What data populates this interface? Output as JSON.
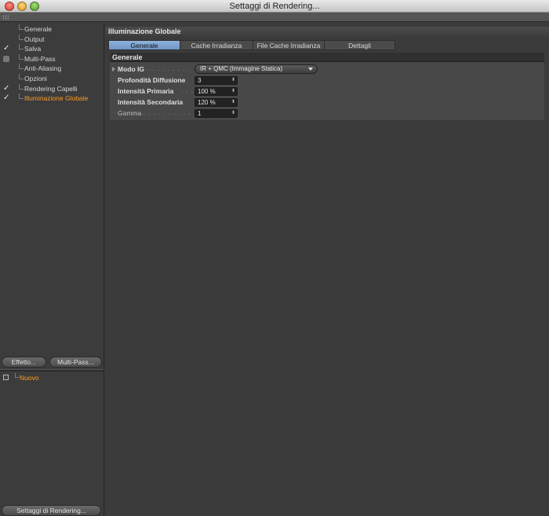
{
  "window": {
    "title": "Settaggi di Rendering..."
  },
  "sidebar": {
    "items": [
      {
        "label": "Generale",
        "state": "none",
        "active": false
      },
      {
        "label": "Output",
        "state": "none",
        "active": false
      },
      {
        "label": "Salva",
        "state": "check",
        "active": false
      },
      {
        "label": "Multi-Pass",
        "state": "box",
        "active": false
      },
      {
        "label": "Anti-Aliasing",
        "state": "none",
        "active": false
      },
      {
        "label": "Opzioni",
        "state": "none",
        "active": false
      },
      {
        "label": "Rendering Capelli",
        "state": "check",
        "active": false
      },
      {
        "label": "Illuminazione Globale",
        "state": "check",
        "active": true
      }
    ],
    "effetto_label": "Effetto...",
    "multipass_label": "Multi-Pass...",
    "preset_label": "Nuovo",
    "settings_button_label": "Settaggi di Rendering..."
  },
  "main": {
    "section_title": "Illuminazione Globale",
    "tabs": [
      {
        "label": "Generale",
        "active": true
      },
      {
        "label": "Cache Irradianza",
        "active": false
      },
      {
        "label": "File Cache Irradianza",
        "active": false
      },
      {
        "label": "Dettagli",
        "active": false
      }
    ],
    "group_title": "Generale",
    "fields": {
      "modo_ig": {
        "label": "Modo IG",
        "value": "IR + QMC (Immagine Statica)"
      },
      "profondita": {
        "label": "Profondità Diffusione",
        "value": "3"
      },
      "primaria": {
        "label": "Intensità Primaria",
        "value": "100 %"
      },
      "secondaria": {
        "label": "Intensità Secondaria",
        "value": "120 %"
      },
      "gamma": {
        "label": "Gamma",
        "value": "1"
      }
    }
  },
  "colors": {
    "active_text": "#ff9b20",
    "tab_active": "#7fa4d4",
    "panel_bg": "#3b3b3b"
  }
}
